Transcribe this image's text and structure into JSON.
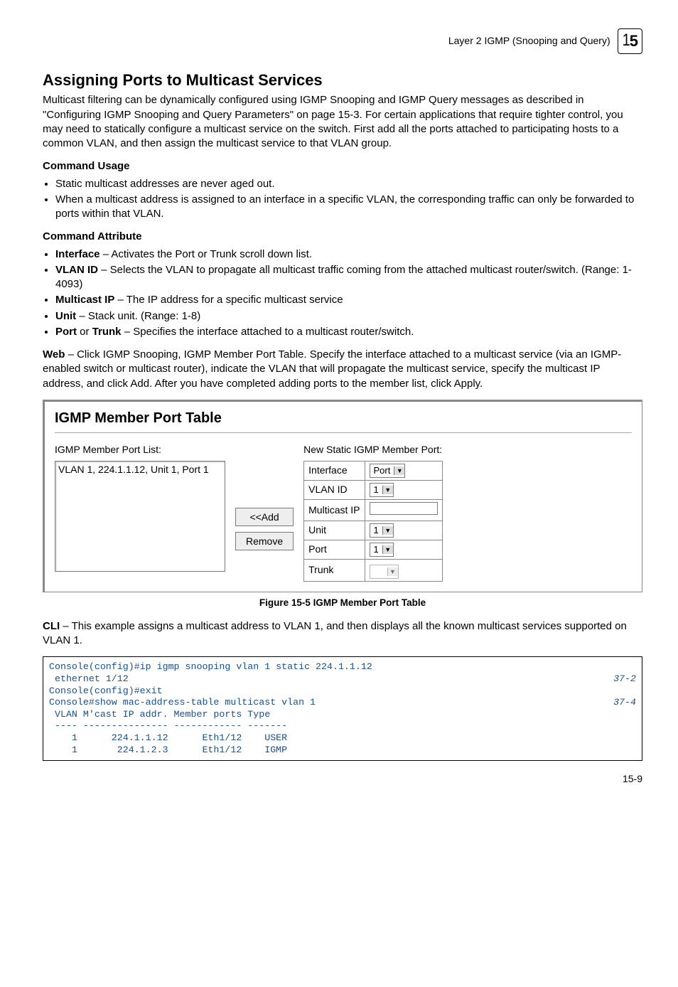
{
  "header": {
    "text": "Layer 2 IGMP (Snooping and Query)",
    "chapter": "15"
  },
  "section_title": "Assigning Ports to Multicast Services",
  "intro": "Multicast filtering can be dynamically configured using IGMP Snooping and IGMP Query messages as described in \"Configuring IGMP Snooping and Query Parameters\" on page 15-3. For certain applications that require tighter control, you may need to statically configure a multicast service on the switch. First add all the ports attached to participating hosts to a common VLAN, and then assign the multicast service to that VLAN group.",
  "usage": {
    "heading": "Command Usage",
    "items": [
      "Static multicast addresses are never aged out.",
      "When a multicast address is assigned to an interface in a specific VLAN, the corresponding traffic can only be forwarded to ports within that VLAN."
    ]
  },
  "attr": {
    "heading": "Command Attribute",
    "items": [
      {
        "b": "Interface",
        "t": " – Activates the Port or Trunk scroll down list."
      },
      {
        "b": "VLAN ID",
        "t": " – Selects the VLAN to propagate all multicast traffic coming from the attached multicast router/switch. (Range: 1-4093)"
      },
      {
        "b": "Multicast IP",
        "t": " – The IP address for a specific multicast service"
      },
      {
        "b": "Unit",
        "t": " – Stack unit. (Range: 1-8)"
      },
      {
        "b": "Port",
        "b2": "Trunk",
        "mid": " or ",
        "t": " – Specifies the interface attached to a multicast router/switch."
      }
    ]
  },
  "web_para_lead": "Web",
  "web_para": " – Click IGMP Snooping, IGMP Member Port Table. Specify the interface attached to a multicast service (via an IGMP-enabled switch or multicast router), indicate the VLAN that will propagate the multicast service, specify the multicast IP address, and click Add. After you have completed adding ports to the member list, click Apply.",
  "screenshot": {
    "title": "IGMP Member Port Table",
    "left_label": "IGMP Member Port List:",
    "list_item": "VLAN 1, 224.1.1.12, Unit 1, Port 1",
    "btn_add": "<<Add",
    "btn_remove": "Remove",
    "right_label": "New Static IGMP Member Port:",
    "rows": {
      "interface_lbl": "Interface",
      "interface_val": "Port",
      "vlan_lbl": "VLAN ID",
      "vlan_val": "1",
      "mip_lbl": "Multicast IP",
      "mip_val": "",
      "unit_lbl": "Unit",
      "unit_val": "1",
      "port_lbl": "Port",
      "port_val": "1",
      "trunk_lbl": "Trunk",
      "trunk_val": ""
    }
  },
  "figure_caption": "Figure 15-5   IGMP Member Port Table",
  "cli_para_lead": "CLI",
  "cli_para": " – This example assigns a multicast address to VLAN 1, and then displays all the known multicast services supported on VLAN 1.",
  "code": {
    "l1a": "Console(config)#ip igmp snooping vlan 1 static 224.1.1.12 ",
    "l1b": " ethernet 1/12",
    "pg1": "37-2",
    "l2": "Console(config)#exit",
    "l3": "Console#show mac-address-table multicast vlan 1",
    "pg2": "37-4",
    "l4": " VLAN M'cast IP addr. Member ports Type",
    "l5": " ---- --------------- ------------ -------",
    "l6": "    1      224.1.1.12      Eth1/12    USER",
    "l7": "    1       224.1.2.3      Eth1/12    IGMP"
  },
  "page_num": "15-9"
}
